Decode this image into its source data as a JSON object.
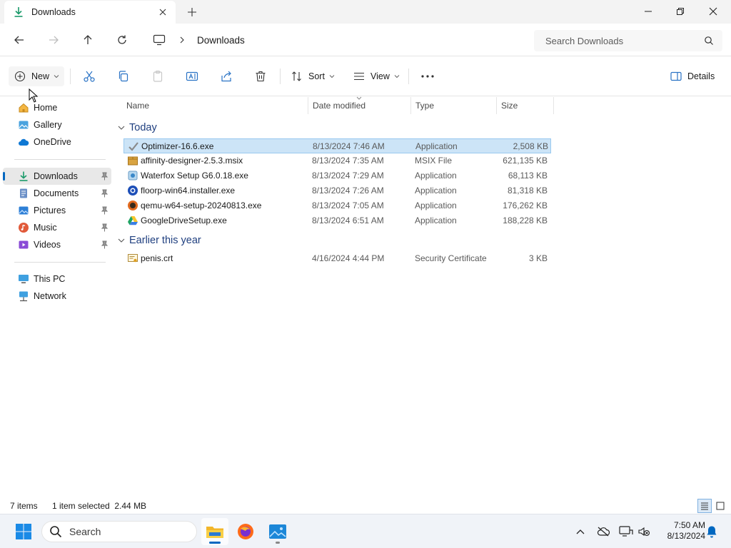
{
  "window": {
    "tab_title": "Downloads"
  },
  "addressbar": {
    "breadcrumb": "Downloads",
    "search_placeholder": "Search Downloads"
  },
  "commandbar": {
    "new_label": "New",
    "sort_label": "Sort",
    "view_label": "View",
    "details_label": "Details"
  },
  "sidebar": {
    "quick": [
      {
        "label": "Home",
        "icon": "home-icon"
      },
      {
        "label": "Gallery",
        "icon": "gallery-icon"
      },
      {
        "label": "OneDrive",
        "icon": "onedrive-icon"
      }
    ],
    "pinned": [
      {
        "label": "Downloads",
        "icon": "downloads-icon",
        "selected": true
      },
      {
        "label": "Documents",
        "icon": "documents-icon"
      },
      {
        "label": "Pictures",
        "icon": "pictures-icon"
      },
      {
        "label": "Music",
        "icon": "music-icon"
      },
      {
        "label": "Videos",
        "icon": "videos-icon"
      }
    ],
    "devices": [
      {
        "label": "This PC",
        "icon": "this-pc-icon"
      },
      {
        "label": "Network",
        "icon": "network-icon"
      }
    ]
  },
  "columns": {
    "name": "Name",
    "date": "Date modified",
    "type": "Type",
    "size": "Size"
  },
  "groups": [
    {
      "label": "Today",
      "files": [
        {
          "name": "Optimizer-16.6.exe",
          "date": "8/13/2024 7:46 AM",
          "type": "Application",
          "size": "2,508 KB",
          "selected": true,
          "icon": "optimizer-icon"
        },
        {
          "name": "affinity-designer-2.5.3.msix",
          "date": "8/13/2024 7:35 AM",
          "type": "MSIX File",
          "size": "621,135 KB",
          "icon": "package-icon"
        },
        {
          "name": "Waterfox Setup G6.0.18.exe",
          "date": "8/13/2024 7:29 AM",
          "type": "Application",
          "size": "68,113 KB",
          "icon": "installer-icon"
        },
        {
          "name": "floorp-win64.installer.exe",
          "date": "8/13/2024 7:26 AM",
          "type": "Application",
          "size": "81,318 KB",
          "icon": "floorp-icon"
        },
        {
          "name": "qemu-w64-setup-20240813.exe",
          "date": "8/13/2024 7:05 AM",
          "type": "Application",
          "size": "176,262 KB",
          "icon": "qemu-icon"
        },
        {
          "name": "GoogleDriveSetup.exe",
          "date": "8/13/2024 6:51 AM",
          "type": "Application",
          "size": "188,228 KB",
          "icon": "google-drive-icon"
        }
      ]
    },
    {
      "label": "Earlier this year",
      "files": [
        {
          "name": "penis.crt",
          "date": "4/16/2024 4:44 PM",
          "type": "Security Certificate",
          "size": "3 KB",
          "icon": "certificate-icon"
        }
      ]
    }
  ],
  "status": {
    "items_count": "7 items",
    "selection": "1 item selected  2.44 MB"
  },
  "taskbar": {
    "search_label": "Search",
    "time": "7:50 AM",
    "date": "8/13/2024"
  },
  "colors": {
    "accent": "#0067c0",
    "selection_bg": "#cce4f7",
    "group_header": "#1f3f7f"
  }
}
